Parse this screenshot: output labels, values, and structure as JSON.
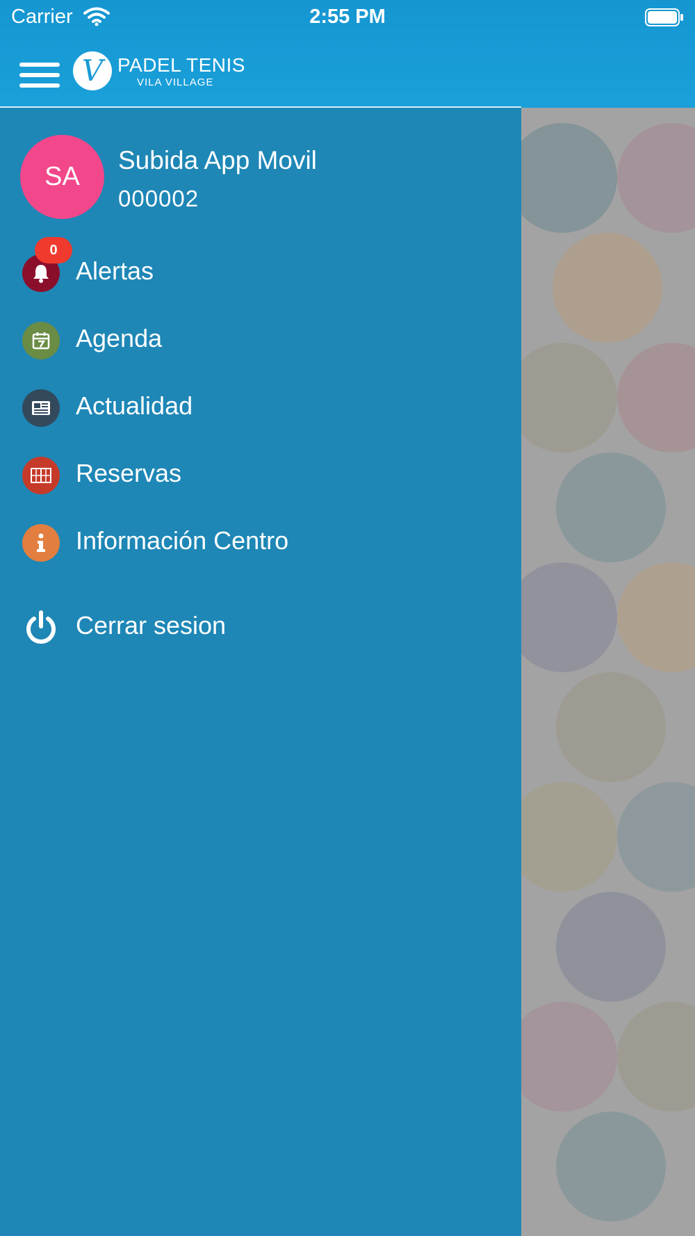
{
  "status_bar": {
    "carrier": "Carrier",
    "time": "2:55 PM"
  },
  "header": {
    "logo_title": "PADEL TENIS",
    "logo_subtitle": "VILA VILLAGE",
    "logo_mark": "V"
  },
  "user": {
    "initials": "SA",
    "name": "Subida App Movil",
    "id": "000002"
  },
  "menu": {
    "items": [
      {
        "label": "Alertas",
        "icon": "bell-icon",
        "color": "#8b0f2b",
        "badge": "0"
      },
      {
        "label": "Agenda",
        "icon": "calendar-icon",
        "color": "#6a8c45"
      },
      {
        "label": "Actualidad",
        "icon": "newspaper-icon",
        "color": "#33495c"
      },
      {
        "label": "Reservas",
        "icon": "court-icon",
        "color": "#c63a2a"
      },
      {
        "label": "Información Centro",
        "icon": "info-icon",
        "color": "#e27e3f"
      },
      {
        "label": "Cerrar sesion",
        "icon": "power-icon",
        "color": "#ffffff"
      }
    ]
  },
  "colors": {
    "header_blue": "#1a9ad6",
    "drawer_blue": "#1e87b6",
    "avatar_pink": "#f2478b",
    "badge_red": "#f03a2e"
  }
}
